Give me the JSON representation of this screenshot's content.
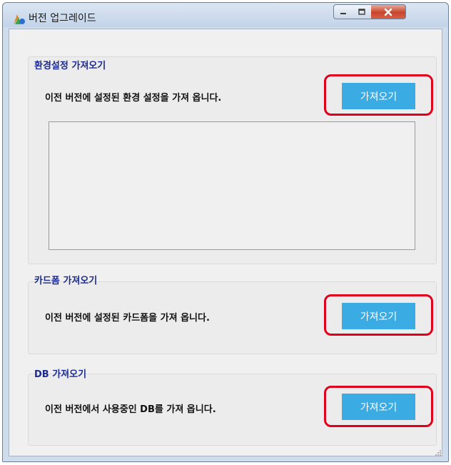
{
  "window": {
    "title": "버전 업그레이드",
    "controls": {
      "minimize": "minimize",
      "maximize": "maximize",
      "close": "close"
    }
  },
  "sections": [
    {
      "title": "환경설정 가져오기",
      "description": "이전 버전에 설정된 환경 설정을 가져 옵니다.",
      "button_label": "가져오기"
    },
    {
      "title": "카드폼 가져오기",
      "description": "이전 버전에 설정된 카드폼을 가져 옵니다.",
      "button_label": "가져오기"
    },
    {
      "title": "DB 가져오기",
      "description": "이전 버전에서 사용중인 DB를 가져 옵니다.",
      "button_label": "가져오기"
    }
  ],
  "colors": {
    "accent_button": "#3aabe3",
    "highlight": "#e0001b",
    "group_title": "#1d2a8f"
  },
  "icons": {
    "app": "app-icon",
    "minimize": "minimize-icon",
    "maximize": "maximize-icon",
    "close": "close-icon"
  }
}
